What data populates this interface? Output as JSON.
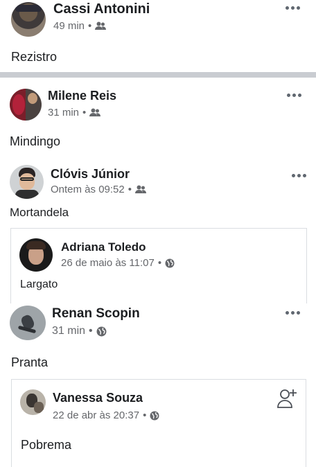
{
  "posts": [
    {
      "name": "Cassi Antonini",
      "time": "49 min",
      "audience_icon": "friends-icon",
      "text": "Rezistro"
    },
    {
      "name": "Milene Reis",
      "time": "31 min",
      "audience_icon": "friends-icon",
      "text": "Mindingo"
    },
    {
      "name": "Clóvis Júnior",
      "time": "Ontem às 09:52",
      "audience_icon": "friends-icon",
      "text": "Mortandela",
      "shared": {
        "name": "Adriana Toledo",
        "time": "26 de maio às 11:07",
        "audience_icon": "globe-icon",
        "text": "Largato"
      }
    },
    {
      "name": "Renan Scopin",
      "time": "31 min",
      "audience_icon": "globe-icon",
      "text": "Pranta",
      "shared": {
        "name": "Vanessa Souza",
        "time": "22 de abr às 20:37",
        "audience_icon": "globe-icon",
        "text": "Pobrema",
        "action_icon": "add-friend-icon"
      }
    }
  ],
  "separator": "•",
  "colors": {
    "text": "#1c1e21",
    "meta": "#65676b",
    "divider": "#c9ccd1",
    "border": "#dadde1"
  }
}
